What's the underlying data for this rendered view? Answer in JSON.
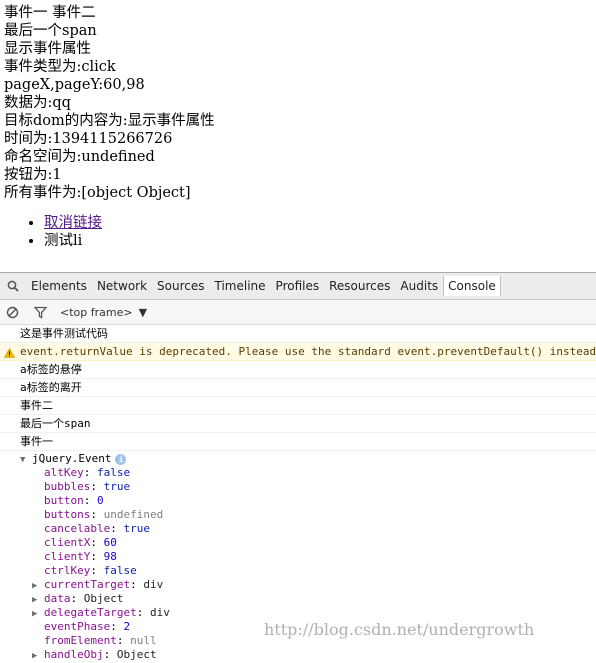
{
  "page": {
    "lines": [
      "事件一 事件二",
      "最后一个span",
      "显示事件属性",
      "事件类型为:click",
      "pageX,pageY:60,98",
      "数据为:qq",
      "目标dom的内容为:显示事件属性",
      "时间为:1394115266726",
      "命名空间为:undefined",
      "按钮为:1",
      "所有事件为:[object Object]"
    ],
    "list": {
      "link": "取消链接",
      "item": "测试li"
    }
  },
  "devtools": {
    "tabs": [
      "Elements",
      "Network",
      "Sources",
      "Timeline",
      "Profiles",
      "Resources",
      "Audits",
      "Console"
    ],
    "active_tab": "Console",
    "frame": "<top frame>",
    "messages": [
      {
        "text": "这是事件测试代码",
        "type": "log"
      },
      {
        "text": "event.returnValue is deprecated. Please use the standard event.preventDefault() instead.",
        "type": "warning"
      },
      {
        "text": "a标签的悬停",
        "type": "log"
      },
      {
        "text": "a标签的离开",
        "type": "log"
      },
      {
        "text": "事件二",
        "type": "log"
      },
      {
        "text": "最后一个span",
        "type": "log"
      },
      {
        "text": "事件一",
        "type": "log"
      }
    ],
    "object": {
      "name": "jQuery.Event",
      "props": [
        {
          "k": "altKey",
          "v": "false",
          "t": "bool"
        },
        {
          "k": "bubbles",
          "v": "true",
          "t": "bool"
        },
        {
          "k": "button",
          "v": "0",
          "t": "num"
        },
        {
          "k": "buttons",
          "v": "undefined",
          "t": "undef"
        },
        {
          "k": "cancelable",
          "v": "true",
          "t": "bool"
        },
        {
          "k": "clientX",
          "v": "60",
          "t": "num"
        },
        {
          "k": "clientY",
          "v": "98",
          "t": "num"
        },
        {
          "k": "ctrlKey",
          "v": "false",
          "t": "bool"
        },
        {
          "k": "currentTarget",
          "v": "div",
          "t": "obj"
        },
        {
          "k": "data",
          "v": "Object",
          "t": "obj"
        },
        {
          "k": "delegateTarget",
          "v": "div",
          "t": "obj"
        },
        {
          "k": "eventPhase",
          "v": "2",
          "t": "num"
        },
        {
          "k": "fromElement",
          "v": "null",
          "t": "undef"
        },
        {
          "k": "handleObj",
          "v": "Object",
          "t": "obj"
        }
      ]
    }
  },
  "watermark": "http://blog.csdn.net/undergrowth"
}
